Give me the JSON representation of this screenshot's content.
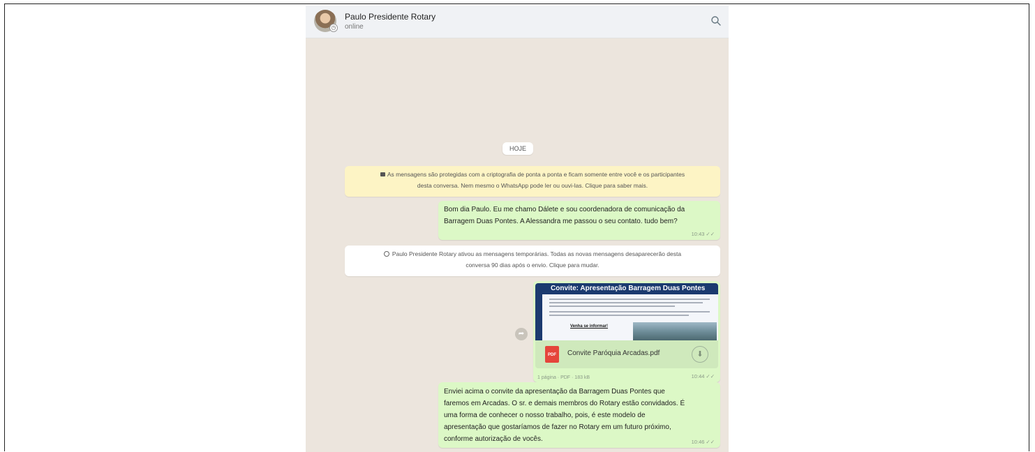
{
  "header": {
    "contact_name": "Paulo Presidente Rotary",
    "status": "online",
    "icons": {
      "avatar": "avatar",
      "search": "search-icon"
    }
  },
  "day_divider": "HOJE",
  "system": {
    "encryption_line1": "As mensagens são protegidas com a criptografia de ponta a ponta e ficam somente entre você e os participantes",
    "encryption_line2": "desta conversa. Nem mesmo o WhatsApp pode ler ou ouvi-las. Clique para saber mais.",
    "temporary_line1": "Paulo Presidente Rotary ativou as mensagens temporárias. Todas as novas mensagens desaparecerão desta",
    "temporary_line2": "conversa 90 dias após o envio. Clique para mudar."
  },
  "messages": [
    {
      "line1": "Bom dia Paulo. Eu me chamo Dálete e sou coordenadora de comunicação da",
      "line2": "Barragem Duas Pontes. A Alessandra me passou o seu contato. tudo bem?",
      "time": "10:43"
    },
    {
      "doc_banner_bold": "Convite:",
      "doc_banner_rest": " Apresentação Barragem Duas Pontes",
      "doc_cta": "Venha se informar!",
      "file_name": "Convite Paróquia Arcadas.pdf",
      "pdf_label": "PDF",
      "file_meta": "1 página · PDF · 183 kB",
      "time": "10:44"
    },
    {
      "line1": "Enviei acima o convite da apresentação da Barragem Duas Pontes que",
      "line2": "faremos em Arcadas. O sr. e demais membros do Rotary estão convidados. É",
      "line3": "uma forma de conhecer o nosso trabalho, pois, é este modelo de",
      "line4": "apresentação que gostaríamos de fazer no Rotary em um futuro próximo,",
      "line5": "conforme autorização de vocês.",
      "time": "10:46"
    }
  ],
  "colors": {
    "chat_background": "#ece5dd",
    "outgoing_bubble": "#dcf8c6",
    "encryption_notice": "#fdf4c5",
    "header": "#f0f2f5",
    "pdf_red": "#e5453b",
    "banner_blue": "#1b3a6f"
  }
}
